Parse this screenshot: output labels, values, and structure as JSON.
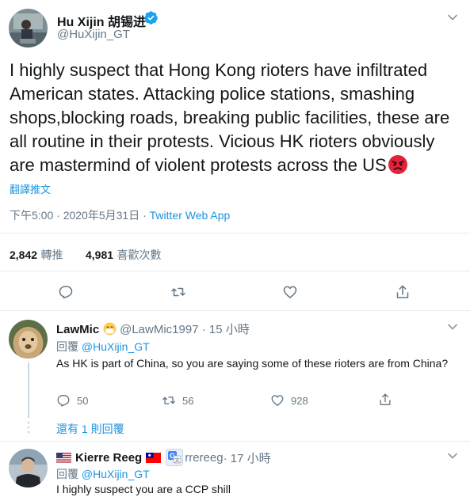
{
  "main_tweet": {
    "author_name": "Hu Xijin 胡锡进",
    "author_handle": "@HuXijin_GT",
    "verified": true,
    "text": "I highly suspect that Hong Kong rioters have infiltrated American states. Attacking police stations, smashing shops,blocking roads, breaking public facilities, these are all routine in their protests. Vicious HK rioters obviously are mastermind of violent protests across the US",
    "emoji": "angry-face",
    "translate_label": "翻譯推文",
    "timestamp": "下午5:00 · 2020年5月31日",
    "dot": " · ",
    "source": "Twitter Web App",
    "retweets_count": "2,842",
    "retweets_label": "轉推",
    "likes_count": "4,981",
    "likes_label": "喜歡次數"
  },
  "replies": [
    {
      "author_name": "LawMic",
      "badge_emoji": "face-with-medical-mask",
      "author_handle": "@LawMic1997",
      "time": " · 15 小時",
      "replying_prefix": "回覆 ",
      "replying_to": "@HuXijin_GT",
      "text": "As HK is part of China, so you are saying some of these rioters are from China?",
      "reply_count": "50",
      "retweet_count": "56",
      "like_count": "928",
      "show_replies": "還有 1 則回覆"
    },
    {
      "author_name": "Kierre Reeg",
      "flags": [
        "us-flag",
        "taiwan-flag"
      ],
      "author_handle": "@...rrereeg",
      "handle_visible": "rrereeg",
      "time": " · 17 小時",
      "replying_prefix": "回覆 ",
      "replying_to": "@HuXijin_GT",
      "text": "I highly suspect you are a CCP shill"
    }
  ],
  "colors": {
    "accent": "#1b95e0",
    "verified": "#1da1f2",
    "muted": "#657786",
    "text": "#14171a",
    "divider": "#e6ecf0"
  }
}
